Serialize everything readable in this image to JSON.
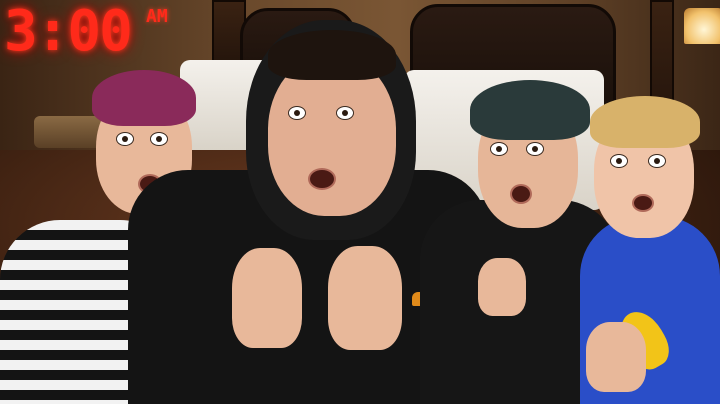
{
  "overlay": {
    "clock_time": "3:00",
    "clock_period": "AM"
  },
  "colors": {
    "clock_red": "#ff2a1a",
    "wall_warm": "#7a5634",
    "bedsheet": "#f4f1ec",
    "hoodie_black": "#141414",
    "sweater_blue": "#2a4ec8"
  },
  "scene": {
    "setting": "hotel-room-at-night",
    "subjects": [
      "person-striped-shirt",
      "person-black-hoodie",
      "person-black-tshirt",
      "person-blue-sweater"
    ]
  }
}
